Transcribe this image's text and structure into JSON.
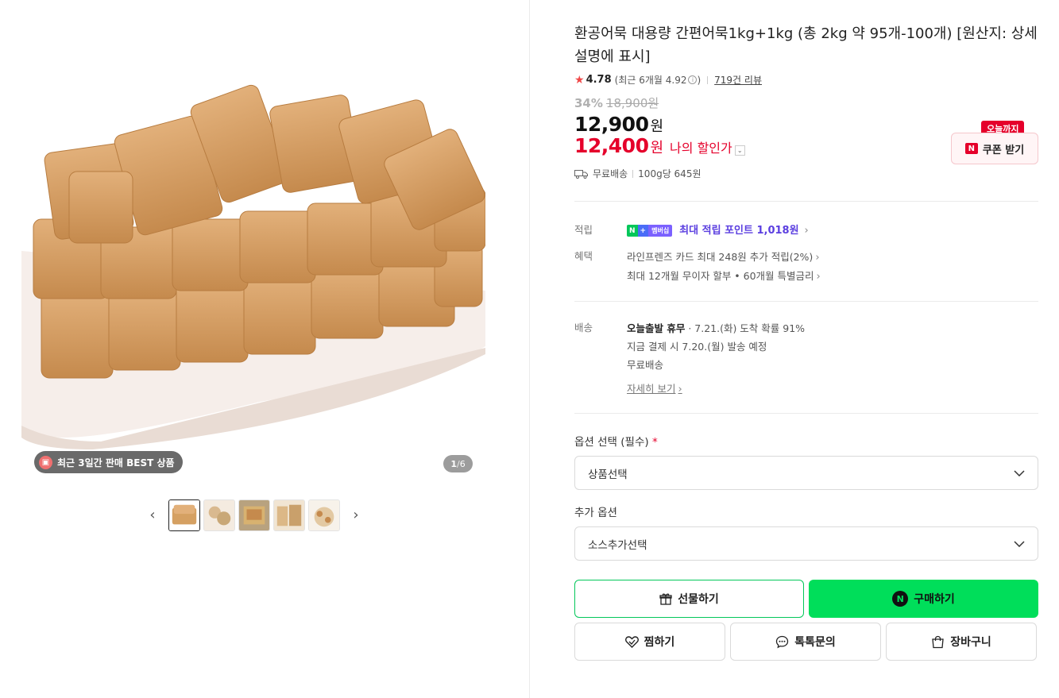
{
  "gallery": {
    "best_badge": "최근 3일간 판매 BEST 상품",
    "page_current": "1",
    "page_total": "6"
  },
  "product": {
    "title": "환공어묵 대용량 간편어묵1kg+1kg (총 2kg 약 95개-100개) [원산지: 상세설명에 표시]",
    "rating": "4.78",
    "recent_rating": "(최근 6개월 4.92",
    "recent_rating_close": ")",
    "review_count": "719건 리뷰",
    "discount_pct": "34%",
    "original_price": "18,900원",
    "price": "12,900",
    "price_unit": "원",
    "my_price": "12,400",
    "my_price_unit": "원",
    "my_price_label": "나의 할인가",
    "shipping": "무료배송",
    "unit_price": "100g당 645원"
  },
  "coupon": {
    "tag": "오늘까지",
    "label": "쿠폰 받기",
    "logo": "N"
  },
  "benefits": {
    "point_label": "적립",
    "np_n": "N",
    "np_plus": "+",
    "np_member": "멤버십",
    "point_text": "최대 적립 포인트 1,018원",
    "benefit_label": "혜택",
    "card_benefit": "라인프렌즈 카드 최대 248원 추가 적립(2%)",
    "installment": "최대 12개월 무이자 할부 • 60개월 특별금리"
  },
  "delivery": {
    "label": "배송",
    "line1_bold": "오늘출발 휴무",
    "line1_rest": " · 7.21.(화) 도착 확률 91%",
    "line2": "지금 결제 시 7.20.(월) 발송 예정",
    "line3": "무료배송",
    "detail_link": "자세히 보기"
  },
  "options": {
    "required_label": "옵션 선택 (필수)",
    "required_mark": "*",
    "required_select": "상품선택",
    "extra_label": "추가 옵션",
    "extra_select": "소스추가선택"
  },
  "actions": {
    "gift": "선물하기",
    "buy": "구매하기",
    "buy_logo": "N",
    "wish": "찜하기",
    "talk": "톡톡문의",
    "cart": "장바구니"
  },
  "icons": [
    "gift-icon",
    "star-icon",
    "info-icon",
    "truck-icon",
    "chevron-right-icon",
    "chevron-down-icon",
    "chevron-left-icon",
    "heart-icon",
    "chat-icon",
    "bag-icon"
  ],
  "colors": {
    "sale_red": "#e5002b",
    "naver_green": "#00de5a",
    "point_purple": "#5b3fe0"
  }
}
